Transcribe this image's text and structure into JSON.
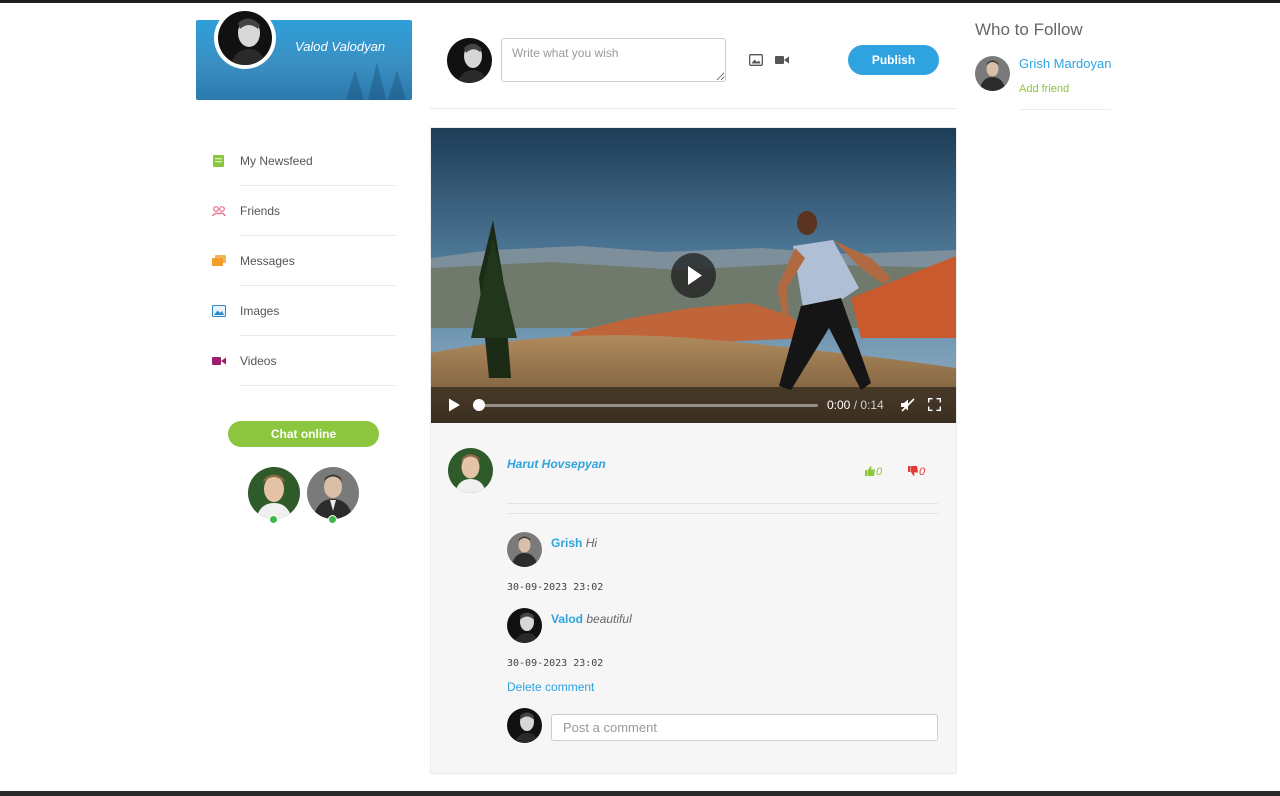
{
  "profile": {
    "name": "Valod Valodyan"
  },
  "menu": {
    "items": [
      {
        "label": "My Newsfeed",
        "icon": "newsfeed-icon",
        "color": "#8cc63f"
      },
      {
        "label": "Friends",
        "icon": "friends-icon",
        "color": "#e86a8a"
      },
      {
        "label": "Messages",
        "icon": "messages-icon",
        "color": "#f39c2a"
      },
      {
        "label": "Images",
        "icon": "images-icon",
        "color": "#2e86c8"
      },
      {
        "label": "Videos",
        "icon": "videos-icon",
        "color": "#9c1f6e"
      }
    ]
  },
  "chat": {
    "button_label": "Chat online"
  },
  "composer": {
    "placeholder": "Write what you wish",
    "publish_label": "Publish"
  },
  "post": {
    "video": {
      "current_time": "0:00",
      "duration": "/ 0:14",
      "progress": 0
    },
    "author": "Harut Hovsepyan",
    "likes": "0",
    "dislikes": "0",
    "comments": [
      {
        "user": "Grish",
        "text": "Hi",
        "date": "30-09-2023 23:02"
      },
      {
        "user": "Valod",
        "text": "beautiful",
        "date": "30-09-2023 23:02"
      }
    ],
    "delete_label": "Delete comment",
    "comment_placeholder": "Post a comment"
  },
  "who_to_follow": {
    "title": "Who to Follow",
    "users": [
      {
        "name": "Grish Mardoyan",
        "action": "Add friend"
      }
    ]
  },
  "colors": {
    "accent_blue": "#2ea3df",
    "accent_green": "#8cc63f",
    "dislike_red": "#e53935"
  }
}
